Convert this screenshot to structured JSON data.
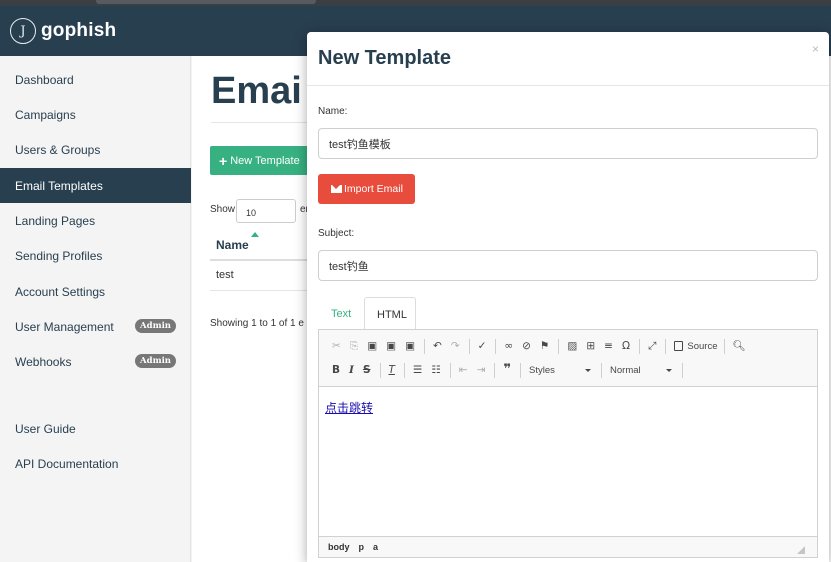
{
  "brand": {
    "logo_glyph": "J",
    "name": "gophish"
  },
  "sidebar": {
    "items": [
      {
        "label": "Dashboard"
      },
      {
        "label": "Campaigns"
      },
      {
        "label": "Users & Groups"
      },
      {
        "label": "Email Templates",
        "active": true
      },
      {
        "label": "Landing Pages"
      },
      {
        "label": "Sending Profiles"
      },
      {
        "label": "Account Settings"
      },
      {
        "label": "User Management",
        "badge": "Admin"
      },
      {
        "label": "Webhooks",
        "badge": "Admin"
      }
    ],
    "footer_items": [
      {
        "label": "User Guide"
      },
      {
        "label": "API Documentation"
      }
    ]
  },
  "main": {
    "title": "Emai",
    "new_button": "New Template",
    "show_label": "Show",
    "show_value": "10",
    "show_suffix": "er",
    "table": {
      "header": "Name",
      "rows": [
        "test"
      ]
    },
    "showing": "Showing 1 to 1 of 1 e"
  },
  "modal": {
    "title": "New Template",
    "close": "×",
    "name_label": "Name:",
    "name_value": "test钓鱼模板",
    "import_button": "Import Email",
    "subject_label": "Subject:",
    "subject_value": "test钓鱼",
    "tabs": [
      "Text",
      "HTML"
    ],
    "active_tab": "HTML",
    "editor": {
      "source_label": "Source",
      "styles_label": "Styles",
      "format_label": "Normal",
      "content_link": "点击跳转",
      "path": [
        "body",
        "p",
        "a"
      ]
    }
  },
  "colors": {
    "navbar": "#283f50",
    "primary_green": "#37b181",
    "danger_red": "#e74c3c",
    "badge_gray": "#777777"
  }
}
